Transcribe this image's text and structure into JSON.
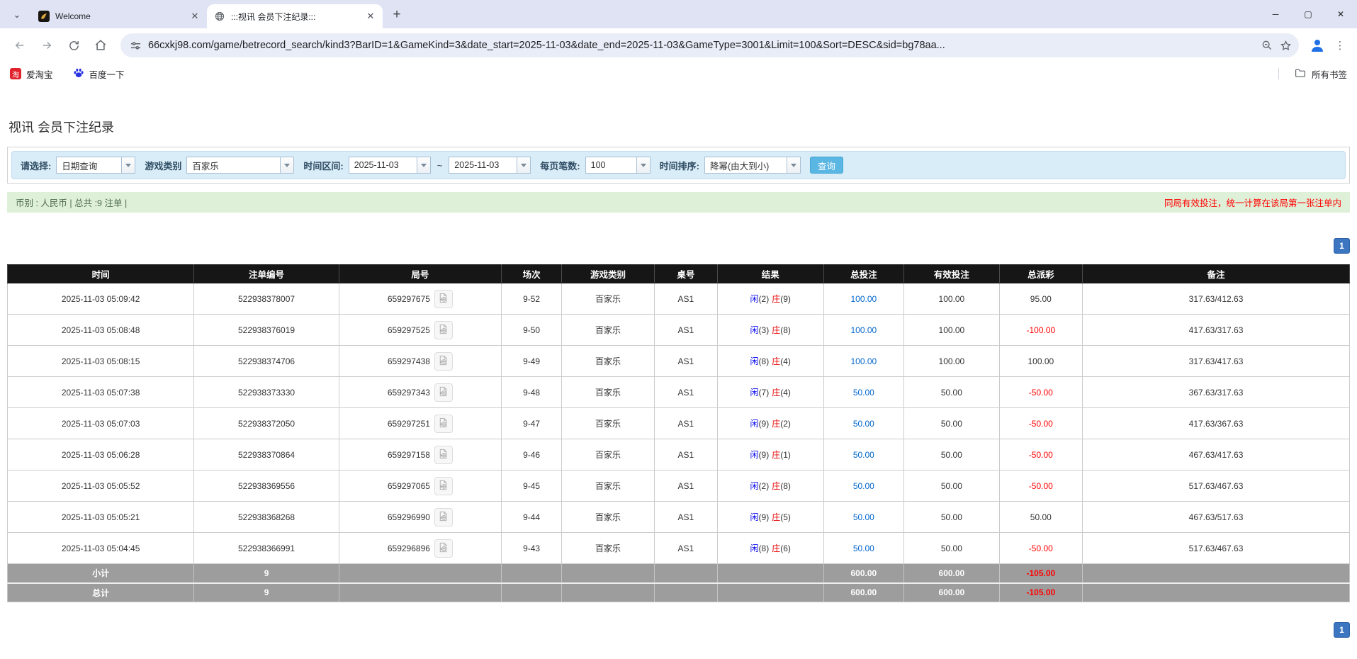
{
  "colors": {
    "header-bg": "#161616",
    "accent-blue": "#3c76c0",
    "link-blue": "#0066cc",
    "player-blue": "#0000ee",
    "banker-red": "#e60000",
    "negative-red": "#ff0000",
    "query-btn-bg": "#5ab6e2",
    "filter-bg": "#d9edf8",
    "summary-bg": "#dff0d8",
    "sum-row-bg": "#9d9d9d"
  },
  "icons": {
    "tab_search": "⌄",
    "tab_close": "✕",
    "new_tab": "+",
    "minimize": "─",
    "maximize": "▢",
    "window_close": "✕",
    "kebab": "⋮",
    "taobao_glyph": "淘"
  },
  "browser": {
    "tabs": [
      {
        "title": "Welcome"
      },
      {
        "title": ":::视讯 会员下注纪录:::"
      }
    ],
    "url": "66cxkj98.com/game/betrecord_search/kind3?BarID=1&GameKind=3&date_start=2025-11-03&date_end=2025-11-03&GameType=3001&Limit=100&Sort=DESC&sid=bg78aa...",
    "bookmarks": {
      "items": [
        {
          "label": "爱淘宝"
        },
        {
          "label": "百度一下"
        }
      ],
      "all_bookmarks": "所有书签"
    }
  },
  "page": {
    "title": "视讯 会员下注纪录",
    "filters": {
      "select_label": "请选择:",
      "select_value": "日期查询",
      "game_type_label": "游戏类别",
      "game_type_value": "百家乐",
      "date_range_label": "时间区间:",
      "date_start": "2025-11-03",
      "tilde": "~",
      "date_end": "2025-11-03",
      "per_page_label": "每页笔数:",
      "per_page_value": "100",
      "sort_label": "时间排序:",
      "sort_value": "降幂(由大到小)",
      "search_button": "查询"
    },
    "summary": {
      "left": "币别 : 人民币 | 总共 :9 注单 |",
      "right": "同局有效投注，统一计算在该局第一张注单内"
    },
    "pagination": "1",
    "table": {
      "headers": [
        "时间",
        "注单编号",
        "局号",
        "场次",
        "游戏类别",
        "桌号",
        "结果",
        "总投注",
        "有效投注",
        "总派彩",
        "备注"
      ],
      "rows": [
        {
          "time": "2025-11-03 05:09:42",
          "bet_no": "522938378007",
          "round_no": "659297675",
          "session": "9-52",
          "game": "百家乐",
          "table_no": "AS1",
          "player": "闲",
          "player_pts": "(2)",
          "banker": "庄",
          "banker_pts": "(9)",
          "total_bet": "100.00",
          "valid_bet": "100.00",
          "payout": "95.00",
          "remark": "317.63/412.63"
        },
        {
          "time": "2025-11-03 05:08:48",
          "bet_no": "522938376019",
          "round_no": "659297525",
          "session": "9-50",
          "game": "百家乐",
          "table_no": "AS1",
          "player": "闲",
          "player_pts": "(3)",
          "banker": "庄",
          "banker_pts": "(8)",
          "total_bet": "100.00",
          "valid_bet": "100.00",
          "payout": "-100.00",
          "remark": "417.63/317.63"
        },
        {
          "time": "2025-11-03 05:08:15",
          "bet_no": "522938374706",
          "round_no": "659297438",
          "session": "9-49",
          "game": "百家乐",
          "table_no": "AS1",
          "player": "闲",
          "player_pts": "(8)",
          "banker": "庄",
          "banker_pts": "(4)",
          "total_bet": "100.00",
          "valid_bet": "100.00",
          "payout": "100.00",
          "remark": "317.63/417.63"
        },
        {
          "time": "2025-11-03 05:07:38",
          "bet_no": "522938373330",
          "round_no": "659297343",
          "session": "9-48",
          "game": "百家乐",
          "table_no": "AS1",
          "player": "闲",
          "player_pts": "(7)",
          "banker": "庄",
          "banker_pts": "(4)",
          "total_bet": "50.00",
          "valid_bet": "50.00",
          "payout": "-50.00",
          "remark": "367.63/317.63"
        },
        {
          "time": "2025-11-03 05:07:03",
          "bet_no": "522938372050",
          "round_no": "659297251",
          "session": "9-47",
          "game": "百家乐",
          "table_no": "AS1",
          "player": "闲",
          "player_pts": "(9)",
          "banker": "庄",
          "banker_pts": "(2)",
          "total_bet": "50.00",
          "valid_bet": "50.00",
          "payout": "-50.00",
          "remark": "417.63/367.63"
        },
        {
          "time": "2025-11-03 05:06:28",
          "bet_no": "522938370864",
          "round_no": "659297158",
          "session": "9-46",
          "game": "百家乐",
          "table_no": "AS1",
          "player": "闲",
          "player_pts": "(9)",
          "banker": "庄",
          "banker_pts": "(1)",
          "total_bet": "50.00",
          "valid_bet": "50.00",
          "payout": "-50.00",
          "remark": "467.63/417.63"
        },
        {
          "time": "2025-11-03 05:05:52",
          "bet_no": "522938369556",
          "round_no": "659297065",
          "session": "9-45",
          "game": "百家乐",
          "table_no": "AS1",
          "player": "闲",
          "player_pts": "(2)",
          "banker": "庄",
          "banker_pts": "(8)",
          "total_bet": "50.00",
          "valid_bet": "50.00",
          "payout": "-50.00",
          "remark": "517.63/467.63"
        },
        {
          "time": "2025-11-03 05:05:21",
          "bet_no": "522938368268",
          "round_no": "659296990",
          "session": "9-44",
          "game": "百家乐",
          "table_no": "AS1",
          "player": "闲",
          "player_pts": "(9)",
          "banker": "庄",
          "banker_pts": "(5)",
          "total_bet": "50.00",
          "valid_bet": "50.00",
          "payout": "50.00",
          "remark": "467.63/517.63"
        },
        {
          "time": "2025-11-03 05:04:45",
          "bet_no": "522938366991",
          "round_no": "659296896",
          "session": "9-43",
          "game": "百家乐",
          "table_no": "AS1",
          "player": "闲",
          "player_pts": "(8)",
          "banker": "庄",
          "banker_pts": "(6)",
          "total_bet": "50.00",
          "valid_bet": "50.00",
          "payout": "-50.00",
          "remark": "517.63/467.63"
        }
      ],
      "subtotal": {
        "label": "小计",
        "count": "9",
        "total_bet": "600.00",
        "valid_bet": "600.00",
        "payout": "-105.00"
      },
      "total": {
        "label": "总计",
        "count": "9",
        "total_bet": "600.00",
        "valid_bet": "600.00",
        "payout": "-105.00"
      }
    }
  }
}
